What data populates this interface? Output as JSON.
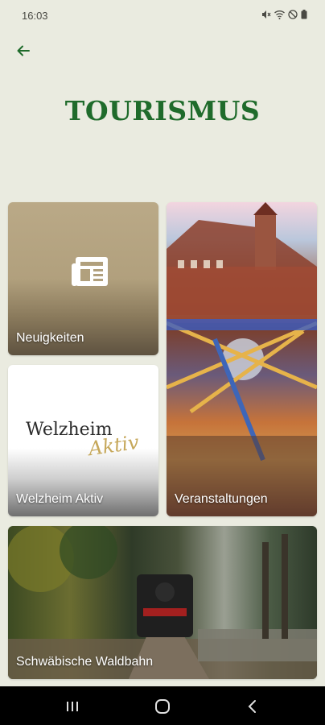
{
  "status_bar": {
    "time": "16:03",
    "icons": [
      "mute-icon",
      "wifi-icon",
      "do-not-disturb-icon",
      "battery-icon"
    ]
  },
  "header": {
    "back_icon": "arrow-left-icon",
    "title": "TOURISMUS",
    "title_color": "#1f6b2b"
  },
  "tiles": [
    {
      "label": "Neuigkeiten",
      "icon": "newspaper-icon"
    },
    {
      "label": "Veranstaltungen"
    },
    {
      "label": "Welzheim Aktiv",
      "logo_main": "Welzheim",
      "logo_sub": "Aktiv"
    },
    {
      "label": "Schwäbische Waldbahn"
    }
  ],
  "nav_bar": {
    "buttons": [
      "recent-apps-icon",
      "home-icon",
      "back-icon"
    ]
  },
  "colors": {
    "background": "#eaebe0",
    "accent": "#1f6b2b"
  }
}
